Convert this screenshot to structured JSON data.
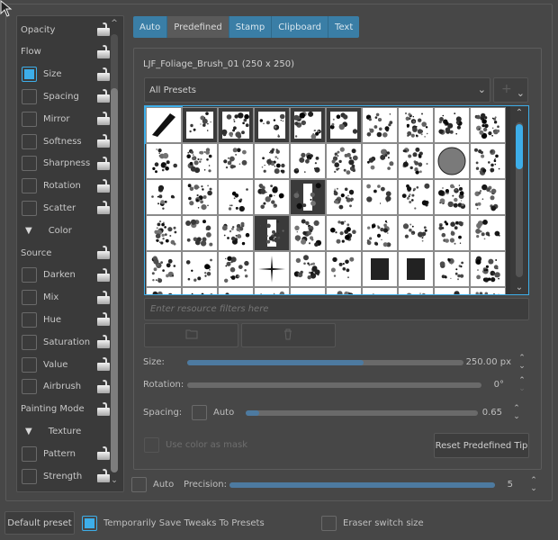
{
  "options_panel": {
    "items": [
      {
        "label": "Opacity",
        "type": "plain",
        "lock": true
      },
      {
        "label": "Flow",
        "type": "plain",
        "lock": true
      },
      {
        "label": "Size",
        "type": "checkbox",
        "checked": true,
        "lock": true
      },
      {
        "label": "Spacing",
        "type": "checkbox",
        "checked": false,
        "lock": true
      },
      {
        "label": "Mirror",
        "type": "checkbox",
        "checked": false,
        "lock": true
      },
      {
        "label": "Softness",
        "type": "checkbox",
        "checked": false,
        "lock": true
      },
      {
        "label": "Sharpness",
        "type": "checkbox",
        "checked": false,
        "lock": true
      },
      {
        "label": "Rotation",
        "type": "checkbox",
        "checked": false,
        "lock": true
      },
      {
        "label": "Scatter",
        "type": "checkbox",
        "checked": false,
        "lock": true
      },
      {
        "label": "Color",
        "type": "group",
        "lock": false
      },
      {
        "label": "Source",
        "type": "plain",
        "lock": true
      },
      {
        "label": "Darken",
        "type": "checkbox",
        "checked": false,
        "lock": true
      },
      {
        "label": "Mix",
        "type": "checkbox",
        "checked": false,
        "lock": true
      },
      {
        "label": "Hue",
        "type": "checkbox",
        "checked": false,
        "lock": true
      },
      {
        "label": "Saturation",
        "type": "checkbox",
        "checked": false,
        "lock": true
      },
      {
        "label": "Value",
        "type": "checkbox",
        "checked": false,
        "lock": true
      },
      {
        "label": "Airbrush",
        "type": "checkbox",
        "checked": false,
        "lock": true
      },
      {
        "label": "Painting Mode",
        "type": "plain",
        "lock": true
      },
      {
        "label": "Texture",
        "type": "group",
        "lock": false
      },
      {
        "label": "Pattern",
        "type": "checkbox",
        "checked": false,
        "lock": true
      },
      {
        "label": "Strength",
        "type": "checkbox",
        "checked": false,
        "lock": true
      }
    ],
    "scroll_up": "^",
    "scroll_down": "⌄"
  },
  "tabs": [
    {
      "label": "Auto",
      "active": false
    },
    {
      "label": "Predefined",
      "active": true
    },
    {
      "label": "Stamp",
      "active": false
    },
    {
      "label": "Clipboard",
      "active": false
    },
    {
      "label": "Text",
      "active": false
    }
  ],
  "predefined": {
    "brush_name": "LJF_Foliage_Brush_01 (250 x 250)",
    "preset_filter": "All Presets",
    "add_icon": "+",
    "filter_placeholder": "Enter resource filters here",
    "import_icon": "folder-icon",
    "delete_icon": "trash-icon",
    "size_label": "Size:",
    "size_value": "250.00 px",
    "size_fraction": 0.64,
    "rotation_label": "Rotation:",
    "rotation_value": "0°",
    "rotation_fraction": 0.0,
    "spacing_label": "Spacing:",
    "spacing_auto_label": "Auto",
    "spacing_auto_checked": false,
    "spacing_value": "0.65",
    "spacing_fraction": 0.06,
    "use_color_mask_label": "Use color as mask",
    "use_color_mask_checked": false,
    "reset_button": "Reset Predefined Tip"
  },
  "precision": {
    "auto_label": "Auto",
    "auto_checked": false,
    "label": "Precision:",
    "value": "5",
    "fraction": 1.0
  },
  "footer": {
    "default_preset_button": "Default preset",
    "save_tweaks_label": "Temporarily Save Tweaks To Presets",
    "save_tweaks_checked": true,
    "eraser_switch_label": "Eraser switch size",
    "eraser_switch_checked": false
  },
  "brush_grid": {
    "columns": 10,
    "visible_rows": 6,
    "selected_index": 0,
    "tips": [
      "stroke",
      "scribble-wide",
      "speckle-square",
      "text-strip",
      "grunge-wide",
      "barcode",
      "vertical-bars",
      "sparse-dots",
      "grunge-cloud",
      "dots-cluster",
      "soft-dots",
      "soft-splats",
      "textured-circle",
      "bubble-ring",
      "small-splats",
      "splat-cluster",
      "scatter-dots",
      "circle-cluster",
      "solid-circle",
      "grunge-block",
      "splat-ink",
      "splat-small",
      "leaves-dark",
      "grunge-round",
      "vertical-line",
      "leaf-fan",
      "soft-cloud",
      "sparkles",
      "foliage-soft",
      "sparse-speckle",
      "hatch-cloud",
      "blur-streaks",
      "soft-smear",
      "narrow-streaks",
      "leaves",
      "fern-leaves",
      "grass-arc",
      "bush",
      "grass-tuft",
      "mound",
      "blot",
      "faint-dots",
      "bricks",
      "star-burst",
      "texture-round",
      "scribble-ball",
      "black-square",
      "black-square-2",
      "feather",
      "feather-2",
      "tip-51",
      "tip-52",
      "tip-53",
      "tip-54",
      "tip-55",
      "tip-56",
      "tip-57",
      "tip-58",
      "tip-59",
      "tip-60"
    ]
  }
}
